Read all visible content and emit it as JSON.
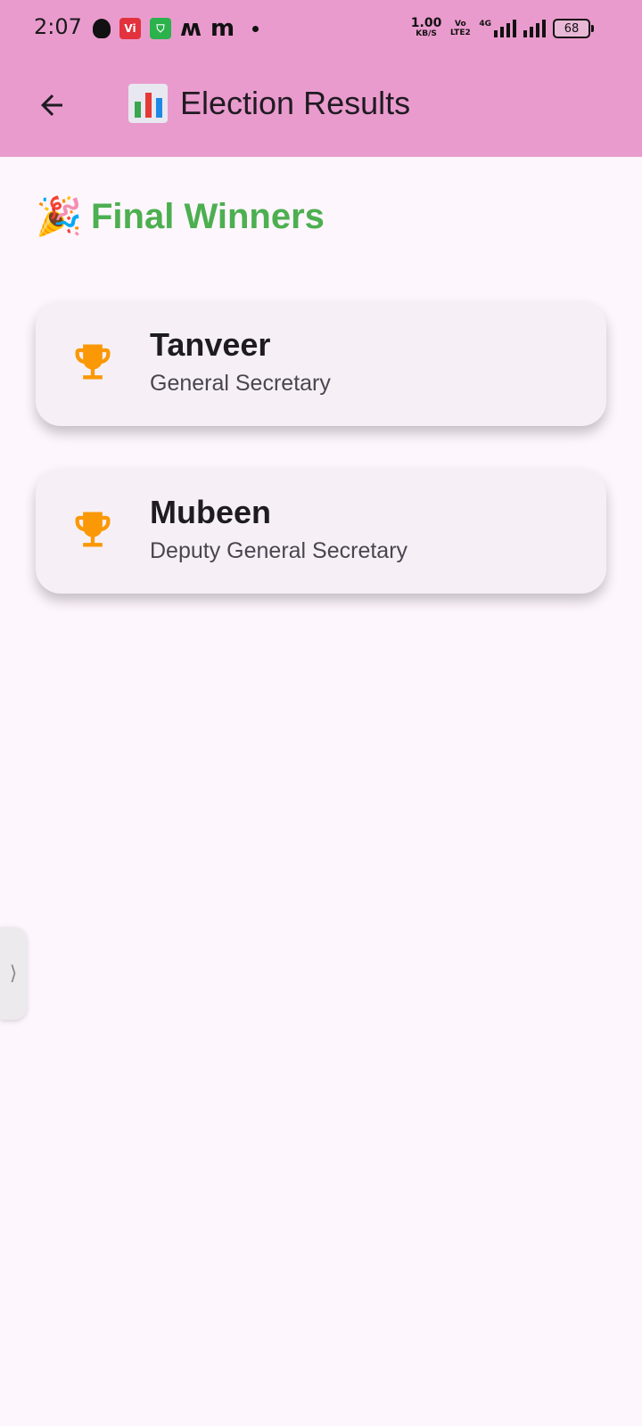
{
  "status_bar": {
    "time": "2:07",
    "notification_icons": [
      "snapchat-icon",
      "vi-icon",
      "shopping-icon",
      "m-icon",
      "m-icon",
      "dot-icon"
    ],
    "vi_label": "Vi",
    "net_speed_value": "1.00",
    "net_speed_unit": "KB/S",
    "volte_label_1": "Vo",
    "volte_label_2": "LTE2",
    "network_label": "4G",
    "battery_level": "68"
  },
  "app_bar": {
    "back_icon": "arrow-back-icon",
    "title_icon": "bar-chart-icon",
    "title": "Election Results",
    "background_color": "#ea9bcd"
  },
  "content": {
    "heading_icon": "party-popper-icon",
    "heading": "Final Winners",
    "heading_color": "#4caf50",
    "winners": [
      {
        "icon": "trophy-icon",
        "name": "Tanveer",
        "position": "General Secretary"
      },
      {
        "icon": "trophy-icon",
        "name": "Mubeen",
        "position": "Deputy General Secretary"
      }
    ],
    "trophy_color": "#fb9805"
  },
  "edge_panel": {
    "icon": "chevron-right-icon",
    "glyph": "⟩"
  }
}
